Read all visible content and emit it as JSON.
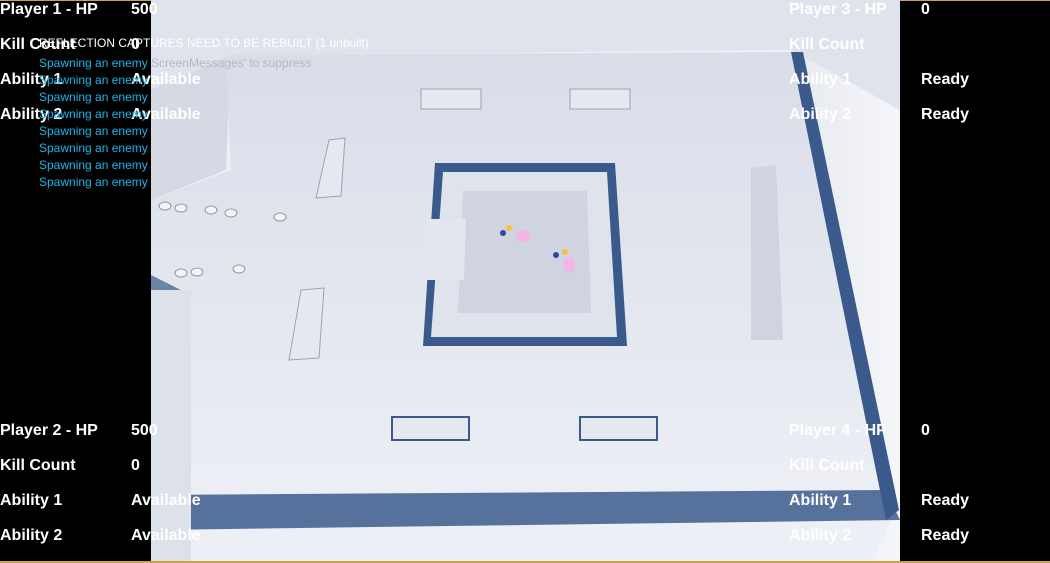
{
  "players": [
    {
      "id": "p1",
      "hp_label": "Player 1 - HP",
      "hp_value": "500",
      "kill_label": "Kill Count",
      "kill_value": "0",
      "ability1_label": "Ability 1",
      "ability1_value": "Available",
      "ability2_label": "Ability 2",
      "ability2_value": "Available"
    },
    {
      "id": "p2",
      "hp_label": "Player 2 - HP",
      "hp_value": "500",
      "kill_label": "Kill Count",
      "kill_value": "0",
      "ability1_label": "Ability 1",
      "ability1_value": "Available",
      "ability2_label": "Ability 2",
      "ability2_value": "Available"
    },
    {
      "id": "p3",
      "hp_label": "Player 3 - HP",
      "hp_value": "0",
      "kill_label": "Kill Count",
      "kill_value": "",
      "ability1_label": "Ability 1",
      "ability1_value": "Ready",
      "ability2_label": "Ability 2",
      "ability2_value": "Ready"
    },
    {
      "id": "p4",
      "hp_label": "Player 4 - HP",
      "hp_value": "0",
      "kill_label": "Kill Count",
      "kill_value": "",
      "ability1_label": "Ability 1",
      "ability1_value": "Ready",
      "ability2_label": "Ability 2",
      "ability2_value": "Ready"
    }
  ],
  "debug": {
    "reflection_warning": "REFLECTION CAPTURES NEED TO BE REBUILT (1 unbuilt)",
    "suppress_hint": "ScreenMessages' to suppress",
    "spawn_messages": [
      "Spawning an enemy",
      "Spawning an enemy",
      "Spawning an enemy",
      "Spawning an enemy",
      "Spawning an enemy",
      "Spawning an enemy",
      "Spawning an enemy",
      "Spawning an enemy"
    ]
  },
  "colors": {
    "hud_text": "#ffffff",
    "debug_cyan": "#17b6ea",
    "debug_grey": "#b6b8c0",
    "floor": "#e9ecf3",
    "wall_edge": "#3b5a8c",
    "frame": "#c8a24a"
  }
}
